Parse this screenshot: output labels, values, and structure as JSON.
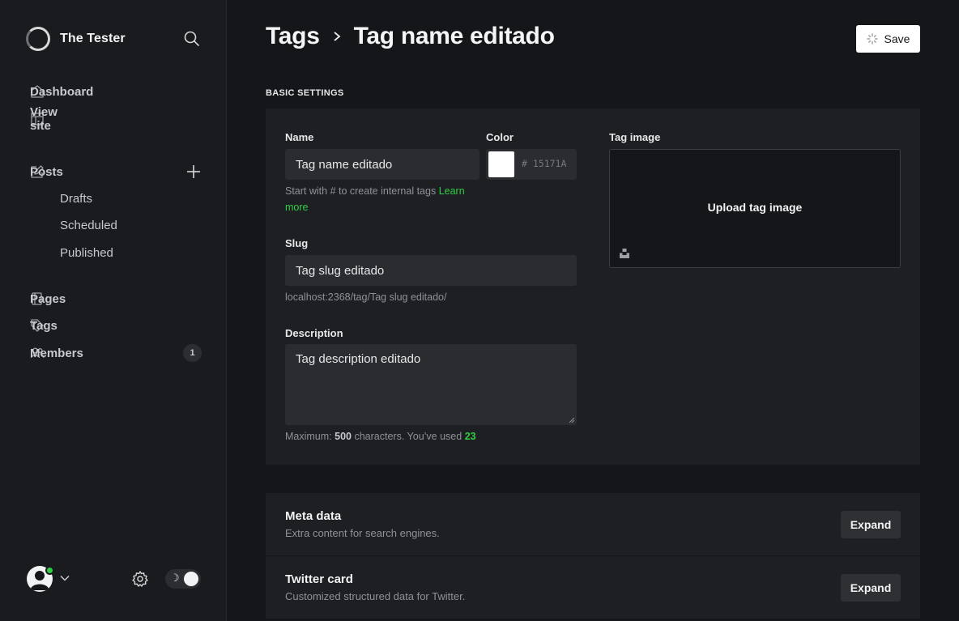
{
  "sidebar": {
    "brand": "The Tester",
    "nav": {
      "dashboard": "Dashboard",
      "view_site": "View site",
      "posts": "Posts",
      "drafts": "Drafts",
      "scheduled": "Scheduled",
      "published": "Published",
      "pages": "Pages",
      "tags": "Tags",
      "members": "Members",
      "members_count": "1"
    },
    "status_color": "#30cf43"
  },
  "header": {
    "breadcrumb_root": "Tags",
    "title": "Tag name editado",
    "save_label": "Save"
  },
  "basic": {
    "section_title": "BASIC SETTINGS",
    "name_label": "Name",
    "name_value": "Tag name editado",
    "color_label": "Color",
    "color_hex": "# 15171A",
    "color_swatch": "#ffffff",
    "name_hint": "Start with # to create internal tags",
    "name_hint_link": "Learn more",
    "slug_label": "Slug",
    "slug_value": "Tag slug editado",
    "slug_url": "localhost:2368/tag/Tag slug editado/",
    "description_label": "Description",
    "description_value": "Tag description editado",
    "desc_hint_prefix": "Maximum:",
    "desc_hint_max": "500",
    "desc_hint_mid": "characters. You’ve used",
    "desc_hint_used": "23",
    "image_label": "Tag image",
    "upload_label": "Upload tag image"
  },
  "sections": {
    "meta_title": "Meta data",
    "meta_sub": "Extra content for search engines.",
    "twitter_title": "Twitter card",
    "twitter_sub": "Customized structured data for Twitter.",
    "expand_label": "Expand"
  },
  "icons": [
    "search-icon",
    "home-icon",
    "view-site-icon",
    "edit-icon",
    "plus-icon",
    "pages-icon",
    "tag-icon",
    "members-icon",
    "chevron-down-icon",
    "gear-icon",
    "moon-icon",
    "spinner-icon",
    "unsplash-icon",
    "chevron-right-icon"
  ]
}
